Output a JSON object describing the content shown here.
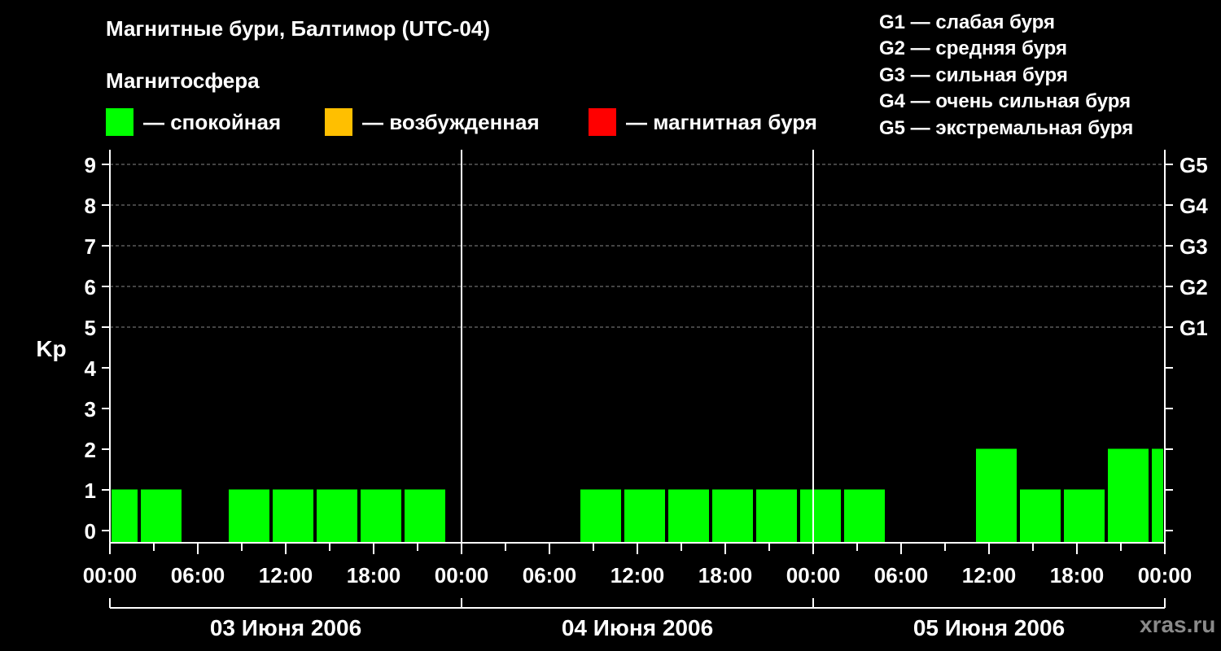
{
  "title": "Магнитные бури, Балтимор (UTC-04)",
  "legend": {
    "heading": "Магнитосфера",
    "items": [
      {
        "label": "— спокойная",
        "color": "#00ff00"
      },
      {
        "label": "— возбужденная",
        "color": "#ffbf00"
      },
      {
        "label": "— магнитная буря",
        "color": "#ff0000"
      }
    ]
  },
  "g_scale": [
    "G1 — слабая буря",
    "G2 — средняя буря",
    "G3 — сильная буря",
    "G4 — очень сильная буря",
    "G5 — экстремальная буря"
  ],
  "watermark": "xras.ru",
  "chart_data": {
    "type": "bar",
    "ylabel": "Kp",
    "ylim": [
      0,
      9
    ],
    "y_ticks": [
      0,
      1,
      2,
      3,
      4,
      5,
      6,
      7,
      8,
      9
    ],
    "right_ticks": [
      {
        "kp": 5,
        "label": "G1"
      },
      {
        "kp": 6,
        "label": "G2"
      },
      {
        "kp": 7,
        "label": "G3"
      },
      {
        "kp": 8,
        "label": "G4"
      },
      {
        "kp": 9,
        "label": "G5"
      }
    ],
    "x_range_hours": [
      0,
      72
    ],
    "x_tick_labels": [
      "00:00",
      "06:00",
      "12:00",
      "18:00",
      "00:00",
      "06:00",
      "12:00",
      "18:00",
      "00:00",
      "06:00",
      "12:00",
      "18:00",
      "00:00"
    ],
    "days": [
      "03 Июня 2006",
      "04 Июня 2006",
      "05 Июня 2006"
    ],
    "grid": "dashed horizontal at Kp 5–9",
    "bar_color": "#00ff00",
    "bars": [
      {
        "start_h": 0,
        "end_h": 2,
        "kp": 1
      },
      {
        "start_h": 2,
        "end_h": 5,
        "kp": 1
      },
      {
        "start_h": 8,
        "end_h": 11,
        "kp": 1
      },
      {
        "start_h": 11,
        "end_h": 14,
        "kp": 1
      },
      {
        "start_h": 14,
        "end_h": 17,
        "kp": 1
      },
      {
        "start_h": 17,
        "end_h": 20,
        "kp": 1
      },
      {
        "start_h": 20,
        "end_h": 23,
        "kp": 1
      },
      {
        "start_h": 32,
        "end_h": 35,
        "kp": 1
      },
      {
        "start_h": 35,
        "end_h": 38,
        "kp": 1
      },
      {
        "start_h": 38,
        "end_h": 41,
        "kp": 1
      },
      {
        "start_h": 41,
        "end_h": 44,
        "kp": 1
      },
      {
        "start_h": 44,
        "end_h": 47,
        "kp": 1
      },
      {
        "start_h": 47,
        "end_h": 50,
        "kp": 1
      },
      {
        "start_h": 50,
        "end_h": 53,
        "kp": 1
      },
      {
        "start_h": 59,
        "end_h": 62,
        "kp": 2
      },
      {
        "start_h": 62,
        "end_h": 65,
        "kp": 1
      },
      {
        "start_h": 65,
        "end_h": 68,
        "kp": 1
      },
      {
        "start_h": 68,
        "end_h": 71,
        "kp": 2
      },
      {
        "start_h": 71,
        "end_h": 72,
        "kp": 2
      }
    ]
  }
}
